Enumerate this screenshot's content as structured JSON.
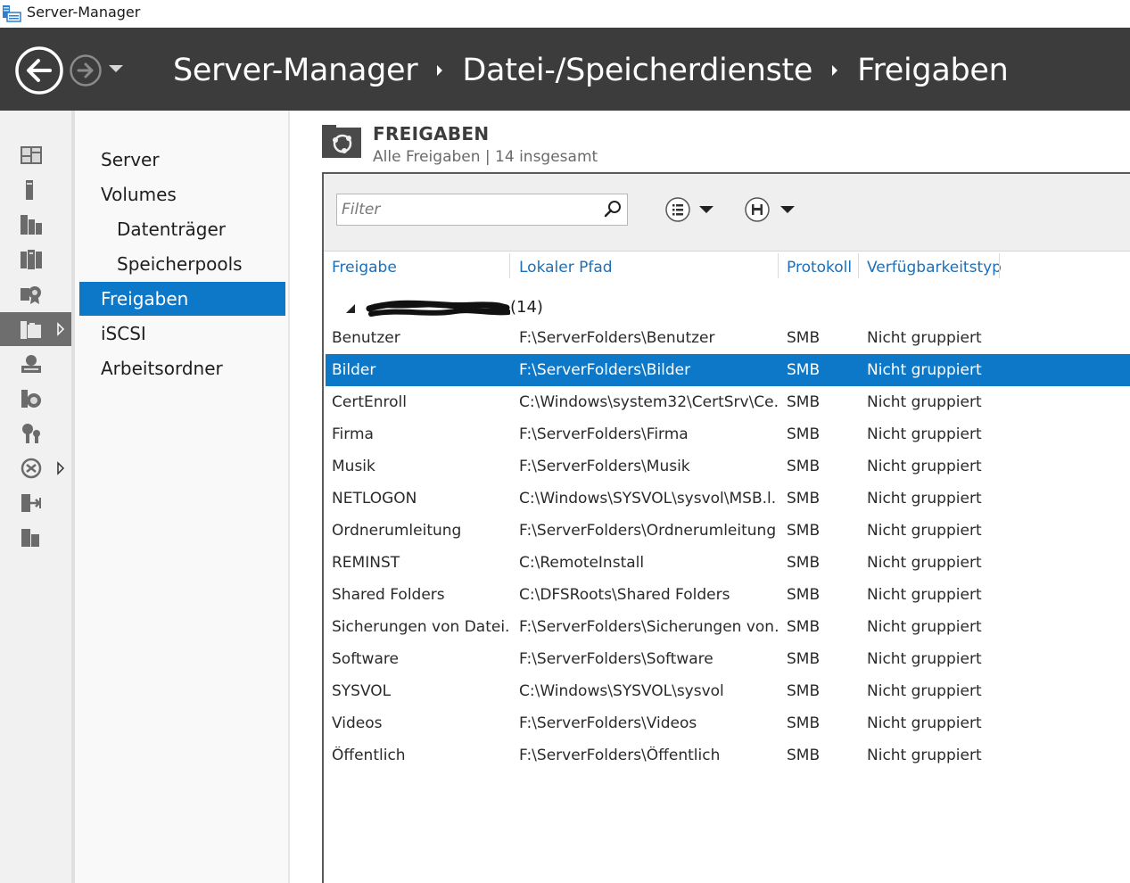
{
  "window": {
    "title": "Server-Manager"
  },
  "breadcrumb": [
    "Server-Manager",
    "Datei-/Speicherdienste",
    "Freigaben"
  ],
  "nav": {
    "items": [
      {
        "label": "Server",
        "sub": false,
        "active": false
      },
      {
        "label": "Volumes",
        "sub": false,
        "active": false
      },
      {
        "label": "Datenträger",
        "sub": true,
        "active": false
      },
      {
        "label": "Speicherpools",
        "sub": true,
        "active": false
      },
      {
        "label": "Freigaben",
        "sub": false,
        "active": true
      },
      {
        "label": "iSCSI",
        "sub": false,
        "active": false
      },
      {
        "label": "Arbeitsordner",
        "sub": false,
        "active": false
      }
    ]
  },
  "section": {
    "title": "FREIGABEN",
    "subtitle": "Alle Freigaben | 14 insgesamt"
  },
  "filter": {
    "placeholder": "Filter",
    "value": ""
  },
  "columns": [
    "Freigabe",
    "Lokaler Pfad",
    "Protokoll",
    "Verfügbarkeitstyp"
  ],
  "group": {
    "label": "(14)"
  },
  "rows": [
    {
      "name": "Benutzer",
      "path": "F:\\ServerFolders\\Benutzer",
      "protocol": "SMB",
      "availability": "Nicht gruppiert",
      "selected": false
    },
    {
      "name": "Bilder",
      "path": "F:\\ServerFolders\\Bilder",
      "protocol": "SMB",
      "availability": "Nicht gruppiert",
      "selected": true
    },
    {
      "name": "CertEnroll",
      "path": "C:\\Windows\\system32\\CertSrv\\Ce...",
      "protocol": "SMB",
      "availability": "Nicht gruppiert",
      "selected": false
    },
    {
      "name": "Firma",
      "path": "F:\\ServerFolders\\Firma",
      "protocol": "SMB",
      "availability": "Nicht gruppiert",
      "selected": false
    },
    {
      "name": "Musik",
      "path": "F:\\ServerFolders\\Musik",
      "protocol": "SMB",
      "availability": "Nicht gruppiert",
      "selected": false
    },
    {
      "name": "NETLOGON",
      "path": "C:\\Windows\\SYSVOL\\sysvol\\MSB.l...",
      "protocol": "SMB",
      "availability": "Nicht gruppiert",
      "selected": false
    },
    {
      "name": "Ordnerumleitung",
      "path": "F:\\ServerFolders\\Ordnerumleitung",
      "protocol": "SMB",
      "availability": "Nicht gruppiert",
      "selected": false
    },
    {
      "name": "REMINST",
      "path": "C:\\RemoteInstall",
      "protocol": "SMB",
      "availability": "Nicht gruppiert",
      "selected": false
    },
    {
      "name": "Shared Folders",
      "path": "C:\\DFSRoots\\Shared Folders",
      "protocol": "SMB",
      "availability": "Nicht gruppiert",
      "selected": false
    },
    {
      "name": "Sicherungen von Datei...",
      "path": "F:\\ServerFolders\\Sicherungen von...",
      "protocol": "SMB",
      "availability": "Nicht gruppiert",
      "selected": false
    },
    {
      "name": "Software",
      "path": "F:\\ServerFolders\\Software",
      "protocol": "SMB",
      "availability": "Nicht gruppiert",
      "selected": false
    },
    {
      "name": "SYSVOL",
      "path": "C:\\Windows\\SYSVOL\\sysvol",
      "protocol": "SMB",
      "availability": "Nicht gruppiert",
      "selected": false
    },
    {
      "name": "Videos",
      "path": "F:\\ServerFolders\\Videos",
      "protocol": "SMB",
      "availability": "Nicht gruppiert",
      "selected": false
    },
    {
      "name": "Öffentlich",
      "path": "F:\\ServerFolders\\Öffentlich",
      "protocol": "SMB",
      "availability": "Nicht gruppiert",
      "selected": false
    }
  ],
  "rail_icons": [
    "dashboard-icon",
    "local-server-icon",
    "all-servers-icon",
    "ad-ds-icon",
    "ad-cs-icon",
    "file-storage-icon",
    "dhcp-icon",
    "dns-icon",
    "iis-icon",
    "nap-icon",
    "remote-access-icon",
    "wsus-icon"
  ],
  "colors": {
    "accent": "#0e78c8",
    "header": "#3c3c3c",
    "link": "#1e6fb6"
  }
}
